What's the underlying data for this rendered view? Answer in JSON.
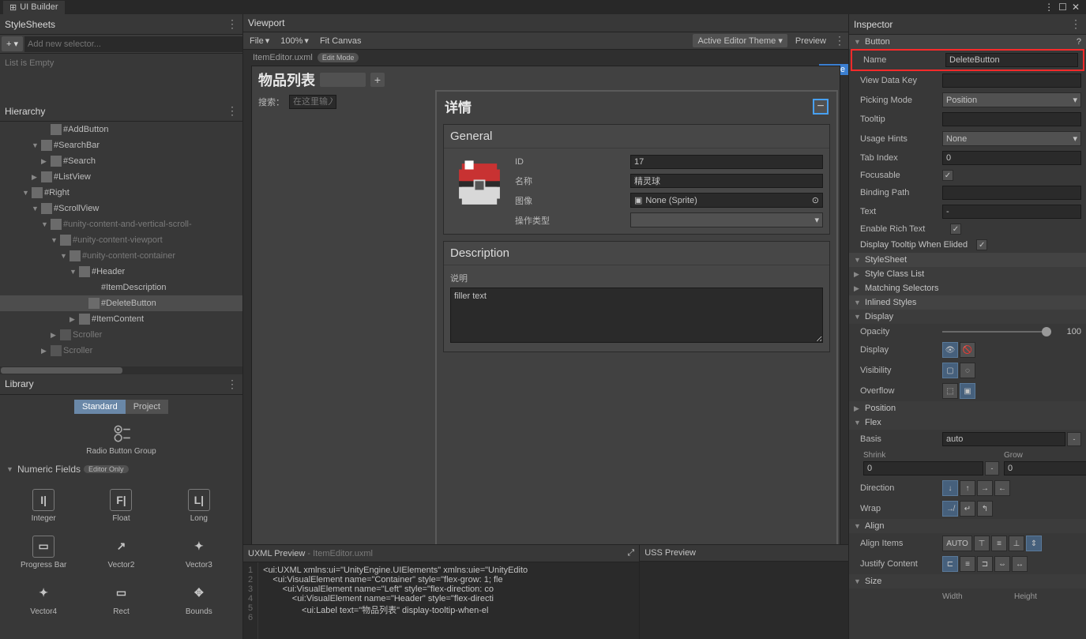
{
  "window": {
    "title": "UI Builder"
  },
  "stylesheets": {
    "title": "StyleSheets",
    "add_placeholder": "Add new selector...",
    "empty": "List is Empty"
  },
  "hierarchy": {
    "title": "Hierarchy",
    "items": [
      {
        "label": "#AddButton",
        "depth": 4,
        "icon": "btn"
      },
      {
        "label": "#SearchBar",
        "depth": 3,
        "icon": "ve",
        "fold": "▼"
      },
      {
        "label": "#Search",
        "depth": 4,
        "icon": "tf",
        "fold": "▶"
      },
      {
        "label": "#ListView",
        "depth": 3,
        "icon": "lv",
        "fold": "▶"
      },
      {
        "label": "#Right",
        "depth": 2,
        "icon": "ve",
        "fold": "▼"
      },
      {
        "label": "#ScrollView",
        "depth": 3,
        "icon": "sv",
        "fold": "▼"
      },
      {
        "label": "#unity-content-and-vertical-scroll-",
        "depth": 4,
        "icon": "ve",
        "fold": "▼",
        "dim": true
      },
      {
        "label": "#unity-content-viewport",
        "depth": 5,
        "icon": "ve",
        "fold": "▼",
        "dim": true
      },
      {
        "label": "#unity-content-container",
        "depth": 6,
        "icon": "ve",
        "fold": "▼",
        "dim": true
      },
      {
        "label": "#Header",
        "depth": 7,
        "icon": "ve",
        "fold": "▼"
      },
      {
        "label": "#ItemDescription",
        "depth": 8,
        "icon": "T"
      },
      {
        "label": "#DeleteButton",
        "depth": 8,
        "icon": "btn",
        "selected": true
      },
      {
        "label": "#ItemContent",
        "depth": 7,
        "icon": "ve",
        "fold": "▶"
      },
      {
        "label": "Scroller",
        "depth": 5,
        "icon": "sc",
        "fold": "▶",
        "dim": true
      },
      {
        "label": "Scroller",
        "depth": 4,
        "icon": "sc",
        "fold": "▶",
        "dim": true
      }
    ]
  },
  "library": {
    "title": "Library",
    "tabs": {
      "standard": "Standard",
      "project": "Project"
    },
    "radio_label": "Radio Button Group",
    "section_numeric": "Numeric Fields",
    "editor_only": "Editor Only",
    "items": {
      "integer": "Integer",
      "float": "Float",
      "long": "Long",
      "progress": "Progress Bar",
      "vec2": "Vector2",
      "vec3": "Vector3",
      "vec4": "Vector4",
      "rect": "Rect",
      "bounds": "Bounds"
    }
  },
  "viewport": {
    "title": "Viewport",
    "file_menu": "File",
    "zoom": "100%",
    "fit": "Fit Canvas",
    "theme": "Active Editor Theme",
    "preview": "Preview",
    "asset_file": "ItemEditor.uxml",
    "edit_mode": "Edit Mode",
    "delete_tag": "#Dele",
    "item_list": {
      "title": "物品列表",
      "search_label": "搜索：",
      "search_placeholder": "在这里输入"
    },
    "detail": {
      "title": "详情",
      "general": {
        "title": "General",
        "id_label": "ID",
        "id_value": "17",
        "name_label": "名称",
        "name_value": "精灵球",
        "image_label": "图像",
        "image_value": "None (Sprite)",
        "optype_label": "操作类型"
      },
      "desc": {
        "title": "Description",
        "label": "说明",
        "value": "filler text"
      }
    }
  },
  "uxml_preview": {
    "title": "UXML Preview",
    "file": "- ItemEditor.uxml",
    "lines": [
      "<ui:UXML xmlns:ui=\"UnityEngine.UIElements\" xmlns:uie=\"UnityEdito",
      "    <ui:VisualElement name=\"Container\" style=\"flex-grow: 1; fle",
      "        <ui:VisualElement name=\"Left\" style=\"flex-direction: co",
      "            <ui:VisualElement name=\"Header\" style=\"flex-directi",
      "                <ui:Label text=\"物品列表\" display-tooltip-when-el"
    ]
  },
  "uss_preview": {
    "title": "USS Preview"
  },
  "inspector": {
    "title": "Inspector",
    "button": "Button",
    "name": {
      "label": "Name",
      "value": "DeleteButton"
    },
    "view_data_key": "View Data Key",
    "picking_mode": {
      "label": "Picking Mode",
      "value": "Position"
    },
    "tooltip": "Tooltip",
    "usage_hints": {
      "label": "Usage Hints",
      "value": "None"
    },
    "tab_index": {
      "label": "Tab Index",
      "value": "0"
    },
    "focusable": "Focusable",
    "binding_path": "Binding Path",
    "text": {
      "label": "Text",
      "value": "-"
    },
    "enable_rich": "Enable Rich Text",
    "display_tooltip": "Display Tooltip When Elided",
    "stylesheet": "StyleSheet",
    "style_class": "Style Class List",
    "matching_sel": "Matching Selectors",
    "inlined": "Inlined Styles",
    "display_sec": "Display",
    "opacity": {
      "label": "Opacity",
      "value": "100"
    },
    "display_label": "Display",
    "visibility": "Visibility",
    "overflow": "Overflow",
    "position": "Position",
    "flex": "Flex",
    "basis": {
      "label": "Basis",
      "value": "auto"
    },
    "shrink": {
      "label": "Shrink",
      "value": "0"
    },
    "grow": {
      "label": "Grow",
      "value": "0"
    },
    "direction": "Direction",
    "wrap": "Wrap",
    "align": "Align",
    "align_items": {
      "label": "Align Items",
      "auto": "AUTO"
    },
    "justify": "Justify Content",
    "size": "Size",
    "width": "Width",
    "height": "Height"
  }
}
